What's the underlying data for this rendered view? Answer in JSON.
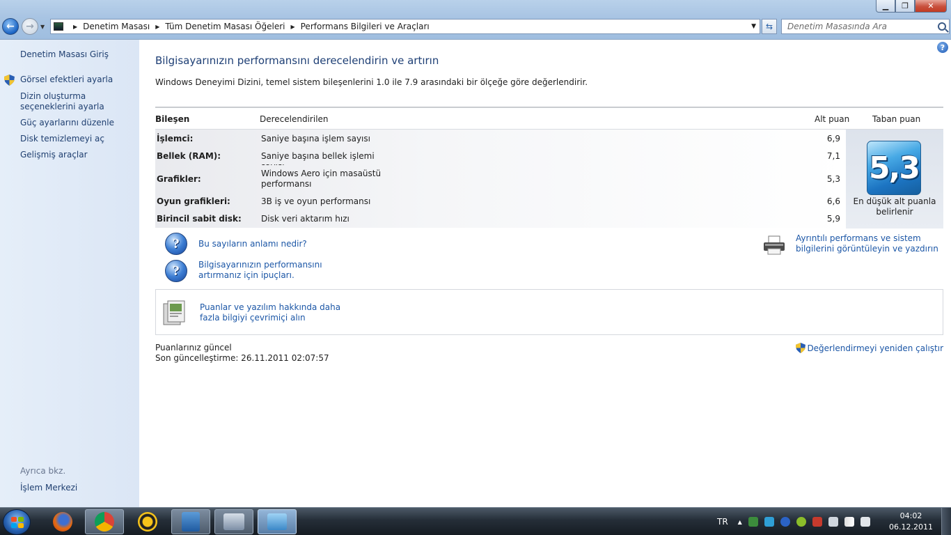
{
  "window": {
    "controls": [
      "minimize",
      "maximize",
      "close"
    ]
  },
  "address": {
    "crumbs": [
      "Denetim Masası",
      "Tüm Denetim Masası Öğeleri",
      "Performans Bilgileri ve Araçları"
    ],
    "search_placeholder": "Denetim Masasında Ara"
  },
  "sidebar": {
    "home": "Denetim Masası Giriş",
    "items": [
      {
        "label": "Görsel efektleri ayarla",
        "shield": true
      },
      {
        "label": "Dizin oluşturma seçeneklerini ayarla",
        "shield": false
      },
      {
        "label": "Güç ayarlarını düzenle",
        "shield": false
      },
      {
        "label": "Disk temizlemeyi aç",
        "shield": false
      },
      {
        "label": "Gelişmiş araçlar",
        "shield": false
      }
    ],
    "see_also": "Ayrıca bkz.",
    "see_also_link": "İşlem Merkezi"
  },
  "main": {
    "title": "Bilgisayarınızın performansını derecelendirin ve artırın",
    "intro": "Windows Deneyimi Dizini, temel sistem bileşenlerini 1.0 ile 7.9 arasındaki bir ölçeğe göre değerlendirir.",
    "table": {
      "headers": {
        "component": "Bileşen",
        "rated": "Derecelendirilen",
        "subscore": "Alt puan",
        "base": "Taban puan"
      },
      "rows": [
        {
          "component": "İşlemci:",
          "rated": "Saniye başına işlem sayısı",
          "subscore": "6,9"
        },
        {
          "component": "Bellek (RAM):",
          "rated": "Saniye başına bellek işlemi sayısı",
          "subscore": "7,1"
        },
        {
          "component": "Grafikler:",
          "rated": "Windows Aero için masaüstü performansı",
          "subscore": "5,3"
        },
        {
          "component": "Oyun grafikleri:",
          "rated": "3B iş ve oyun performansı",
          "subscore": "6,6"
        },
        {
          "component": "Birincil sabit disk:",
          "rated": "Disk veri aktarım hızı",
          "subscore": "5,9"
        }
      ],
      "base_score": "5,3",
      "base_caption": "En düşük alt puanla belirlenir"
    },
    "links": {
      "meaning": "Bu sayıların anlamı nedir?",
      "tips": "Bilgisayarınızın performansını artırmanız için ipuçları.",
      "print": "Ayrıntılı performans ve sistem bilgilerini görüntüleyin ve yazdırın",
      "online": "Puanlar ve yazılım hakkında daha fazla bilgiyi çevrimiçi alın"
    },
    "status": {
      "current": "Puanlarınız güncel",
      "last_update": "Son güncelleştirme: 26.11.2011 02:07:57",
      "rerun": "Değerlendirmeyi yeniden çalıştır"
    }
  },
  "taskbar": {
    "apps": [
      "firefox",
      "chrome",
      "avg",
      "explorer",
      "remote-desktop",
      "control-panel"
    ],
    "lang": "TR",
    "time": "04:02",
    "date": "06.12.2011"
  },
  "colors": {
    "link": "#1b56a6",
    "title": "#1e3f75",
    "sidebar_bg": "#e0eaf7",
    "badge": "#1c74c2"
  }
}
